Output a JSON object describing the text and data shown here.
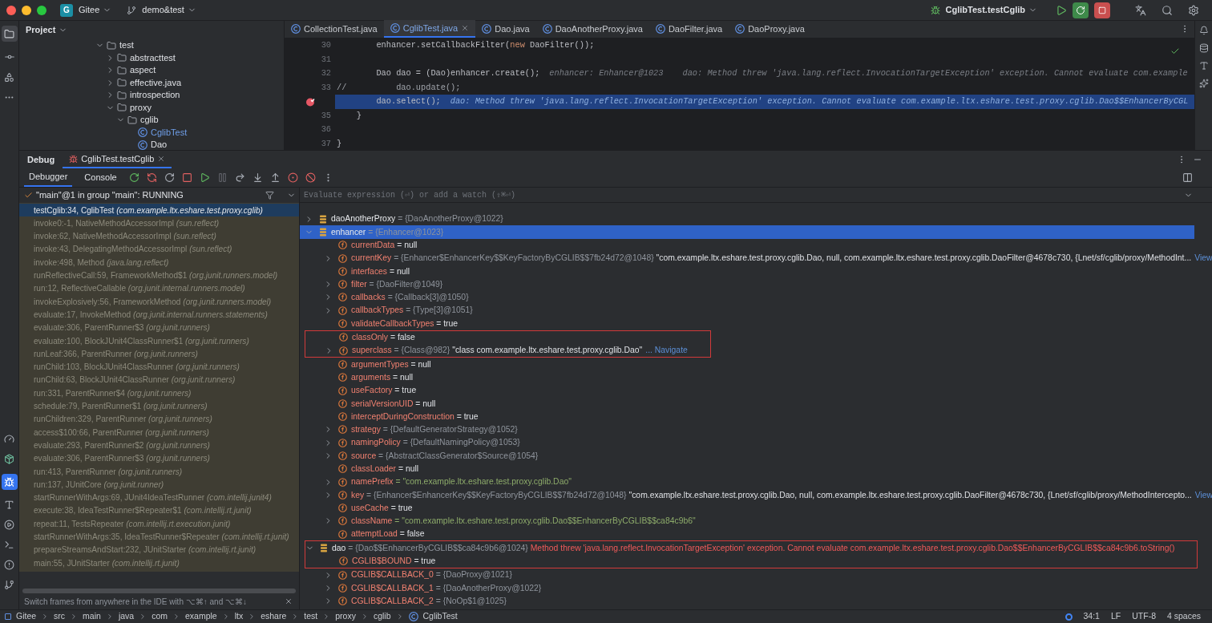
{
  "title_bar": {
    "project_badge": "G",
    "project": "Gitee",
    "branch": "demo&test",
    "run_config": "CglibTest.testCglib"
  },
  "project_panel": {
    "title": "Project",
    "tree": [
      {
        "label": "test",
        "kind": "folder",
        "expanded": true,
        "selected": false,
        "children": [
          {
            "label": "abstracttest",
            "kind": "folder",
            "expanded": false,
            "selected": false
          },
          {
            "label": "aspect",
            "kind": "folder",
            "expanded": false,
            "selected": false
          },
          {
            "label": "effective.java",
            "kind": "folder",
            "expanded": false,
            "selected": false
          },
          {
            "label": "introspection",
            "kind": "folder",
            "expanded": false,
            "selected": false
          },
          {
            "label": "proxy",
            "kind": "folder",
            "expanded": true,
            "selected": false,
            "children": [
              {
                "label": "cglib",
                "kind": "folder",
                "expanded": true,
                "selected": false,
                "children": [
                  {
                    "label": "CglibTest",
                    "kind": "class",
                    "selected": true
                  },
                  {
                    "label": "Dao",
                    "kind": "class",
                    "selected": false
                  }
                ]
              }
            ]
          }
        ]
      }
    ]
  },
  "editor": {
    "tabs": [
      {
        "label": "CollectionTest.java",
        "selected": false
      },
      {
        "label": "CglibTest.java",
        "selected": true
      },
      {
        "label": "Dao.java",
        "selected": false
      },
      {
        "label": "DaoAnotherProxy.java",
        "selected": false
      },
      {
        "label": "DaoFilter.java",
        "selected": false
      },
      {
        "label": "DaoProxy.java",
        "selected": false
      }
    ],
    "lines": [
      {
        "number": "30",
        "current": false,
        "breakpoint": false,
        "code": [
          {
            "text": "        enhancer.setCallbackFilter(",
            "kind": "plain"
          },
          {
            "text": "new",
            "kind": "keyword"
          },
          {
            "text": " DaoFilter());",
            "kind": "plain"
          }
        ]
      },
      {
        "number": "31",
        "current": false,
        "breakpoint": false
      },
      {
        "number": "32",
        "current": false,
        "breakpoint": false,
        "code": [
          {
            "text": "        Dao dao = (Dao)enhancer.create();",
            "kind": "plain"
          }
        ],
        "hints": [
          "enhancer: Enhancer@1023",
          "dao: Method threw 'java.lang.reflect.InvocationTargetException' exception. Cannot evaluate com.example"
        ]
      },
      {
        "number": "33",
        "current": false,
        "breakpoint": false,
        "code": [
          {
            "text": "//          dao.update();",
            "kind": "comment"
          }
        ]
      },
      {
        "current": true,
        "breakpoint": true,
        "code": [
          {
            "text": "        dao.select();",
            "kind": "plain"
          }
        ],
        "hints": [
          "dao: Method threw 'java.lang.reflect.InvocationTargetException' exception. Cannot evaluate com.example.ltx.eshare.test.proxy.cglib.Dao$$EnhancerByCGL"
        ]
      },
      {
        "number": "35",
        "current": false,
        "breakpoint": false,
        "code": [
          {
            "text": "    }",
            "kind": "plain"
          }
        ]
      },
      {
        "number": "36",
        "current": false,
        "breakpoint": false
      },
      {
        "number": "37",
        "current": false,
        "breakpoint": false,
        "code": [
          {
            "text": "}",
            "kind": "plain"
          }
        ]
      }
    ]
  },
  "debug": {
    "title": "Debug",
    "session": "CglibTest.testCglib",
    "tabs": [
      {
        "label": "Debugger",
        "selected": true
      },
      {
        "label": "Console",
        "selected": false
      }
    ],
    "thread": "\"main\"@1 in group \"main\": RUNNING",
    "frames": [
      {
        "text": "testCglib:34, CglibTest *(com.example.ltx.eshare.test.proxy.cglib)*",
        "selected": true
      },
      {
        "text": "invoke0:-1, NativeMethodAccessorImpl *(sun.reflect)*",
        "selected": false
      },
      {
        "text": "invoke:62, NativeMethodAccessorImpl *(sun.reflect)*",
        "selected": false
      },
      {
        "text": "invoke:43, DelegatingMethodAccessorImpl *(sun.reflect)*",
        "selected": false
      },
      {
        "text": "invoke:498, Method *(java.lang.reflect)*",
        "selected": false
      },
      {
        "text": "runReflectiveCall:59, FrameworkMethod$1 *(org.junit.runners.model)*",
        "selected": false
      },
      {
        "text": "run:12, ReflectiveCallable *(org.junit.internal.runners.model)*",
        "selected": false
      },
      {
        "text": "invokeExplosively:56, FrameworkMethod *(org.junit.runners.model)*",
        "selected": false
      },
      {
        "text": "evaluate:17, InvokeMethod *(org.junit.internal.runners.statements)*",
        "selected": false
      },
      {
        "text": "evaluate:306, ParentRunner$3 *(org.junit.runners)*",
        "selected": false
      },
      {
        "text": "evaluate:100, BlockJUnit4ClassRunner$1 *(org.junit.runners)*",
        "selected": false
      },
      {
        "text": "runLeaf:366, ParentRunner *(org.junit.runners)*",
        "selected": false
      },
      {
        "text": "runChild:103, BlockJUnit4ClassRunner *(org.junit.runners)*",
        "selected": false
      },
      {
        "text": "runChild:63, BlockJUnit4ClassRunner *(org.junit.runners)*",
        "selected": false
      },
      {
        "text": "run:331, ParentRunner$4 *(org.junit.runners)*",
        "selected": false
      },
      {
        "text": "schedule:79, ParentRunner$1 *(org.junit.runners)*",
        "selected": false
      },
      {
        "text": "runChildren:329, ParentRunner *(org.junit.runners)*",
        "selected": false
      },
      {
        "text": "access$100:66, ParentRunner *(org.junit.runners)*",
        "selected": false
      },
      {
        "text": "evaluate:293, ParentRunner$2 *(org.junit.runners)*",
        "selected": false
      },
      {
        "text": "evaluate:306, ParentRunner$3 *(org.junit.runners)*",
        "selected": false
      },
      {
        "text": "run:413, ParentRunner *(org.junit.runners)*",
        "selected": false
      },
      {
        "text": "run:137, JUnitCore *(org.junit.runner)*",
        "selected": false
      },
      {
        "text": "startRunnerWithArgs:69, JUnit4IdeaTestRunner *(com.intellij.junit4)*",
        "selected": false
      },
      {
        "text": "execute:38, IdeaTestRunner$Repeater$1 *(com.intellij.rt.junit)*",
        "selected": false
      },
      {
        "text": "repeat:11, TestsRepeater *(com.intellij.rt.execution.junit)*",
        "selected": false
      },
      {
        "text": "startRunnerWithArgs:35, IdeaTestRunner$Repeater *(com.intellij.rt.junit)*",
        "selected": false
      },
      {
        "text": "prepareStreamsAndStart:232, JUnitStarter *(com.intellij.rt.junit)*",
        "selected": false
      },
      {
        "text": "main:55, JUnitStarter *(com.intellij.rt.junit)*",
        "selected": false
      }
    ],
    "frames_hint": "Switch frames from anywhere in the IDE with ⌥⌘↑ and ⌥⌘↓",
    "evaluate_placeholder": "Evaluate expression (⏎) or add a watch (⇧⌘⏎)",
    "variables": [
      {
        "name": "daoAnotherProxy",
        "kind": "local",
        "expanded": false,
        "selected": false,
        "type": "= {DaoAnotherProxy@1022}"
      },
      {
        "name": "enhancer",
        "kind": "local",
        "expanded": true,
        "selected": true,
        "type": "= {Enhancer@1023}",
        "children": [
          {
            "name": "currentData",
            "kind": "field",
            "selected": false,
            "value": "= null"
          },
          {
            "name": "currentKey",
            "kind": "field",
            "expanded": false,
            "selected": false,
            "type": "= {Enhancer$EnhancerKey$$KeyFactoryByCGLIB$$7fb24d72@1048}",
            "detail": "\"com.example.ltx.eshare.test.proxy.cglib.Dao, null, com.example.ltx.eshare.test.proxy.cglib.DaoFilter@4678c730, {Lnet/sf/cglib/proxy/MethodInt...",
            "link": "View"
          },
          {
            "name": "interfaces",
            "kind": "field",
            "selected": false,
            "value": "= null"
          },
          {
            "name": "filter",
            "kind": "field",
            "expanded": false,
            "selected": false,
            "type": "= {DaoFilter@1049}"
          },
          {
            "name": "callbacks",
            "kind": "field",
            "expanded": false,
            "selected": false,
            "type": "= {Callback[3]@1050}"
          },
          {
            "name": "callbackTypes",
            "kind": "field",
            "expanded": false,
            "selected": false,
            "type": "= {Type[3]@1051}"
          },
          {
            "name": "validateCallbackTypes",
            "kind": "field",
            "selected": false,
            "value": "= true"
          },
          {
            "name": "classOnly",
            "kind": "field",
            "selected": false,
            "marked": true,
            "value": "= false"
          },
          {
            "name": "superclass",
            "kind": "field",
            "expanded": false,
            "selected": false,
            "marked": true,
            "type": "= {Class@982}",
            "detail": "\"class com.example.ltx.eshare.test.proxy.cglib.Dao\"",
            "link": "... Navigate"
          },
          {
            "name": "argumentTypes",
            "kind": "field",
            "selected": false,
            "value": "= null"
          },
          {
            "name": "arguments",
            "kind": "field",
            "selected": false,
            "value": "= null"
          },
          {
            "name": "useFactory",
            "kind": "field",
            "selected": false,
            "value": "= true"
          },
          {
            "name": "serialVersionUID",
            "kind": "field",
            "selected": false,
            "value": "= null"
          },
          {
            "name": "interceptDuringConstruction",
            "kind": "field",
            "selected": false,
            "value": "= true"
          },
          {
            "name": "strategy",
            "kind": "field",
            "expanded": false,
            "selected": false,
            "type": "= {DefaultGeneratorStrategy@1052}"
          },
          {
            "name": "namingPolicy",
            "kind": "field",
            "expanded": false,
            "selected": false,
            "type": "= {DefaultNamingPolicy@1053}"
          },
          {
            "name": "source",
            "kind": "field",
            "expanded": false,
            "selected": false,
            "type": "= {AbstractClassGenerator$Source@1054}"
          },
          {
            "name": "classLoader",
            "kind": "field",
            "selected": false,
            "value": "= null"
          },
          {
            "name": "namePrefix",
            "kind": "field",
            "expanded": false,
            "selected": false,
            "string": "= \"com.example.ltx.eshare.test.proxy.cglib.Dao\""
          },
          {
            "name": "key",
            "kind": "field",
            "expanded": false,
            "selected": false,
            "type": "= {Enhancer$EnhancerKey$$KeyFactoryByCGLIB$$7fb24d72@1048}",
            "detail": "\"com.example.ltx.eshare.test.proxy.cglib.Dao, null, com.example.ltx.eshare.test.proxy.cglib.DaoFilter@4678c730, {Lnet/sf/cglib/proxy/MethodIntercepto...",
            "link": "View"
          },
          {
            "name": "useCache",
            "kind": "field",
            "selected": false,
            "value": "= true"
          },
          {
            "name": "className",
            "kind": "field",
            "expanded": false,
            "selected": false,
            "string": "= \"com.example.ltx.eshare.test.proxy.cglib.Dao$$EnhancerByCGLIB$$ca84c9b6\""
          },
          {
            "name": "attemptLoad",
            "kind": "field",
            "selected": false,
            "value": "= false"
          }
        ]
      },
      {
        "name": "dao",
        "kind": "local",
        "expanded": true,
        "selected": false,
        "marked": true,
        "type": "= {Dao$$EnhancerByCGLIB$$ca84c9b6@1024}",
        "error": "Method threw 'java.lang.reflect.InvocationTargetException' exception. Cannot evaluate com.example.ltx.eshare.test.proxy.cglib.Dao$$EnhancerByCGLIB$$ca84c9b6.toString()",
        "children": [
          {
            "name": "CGLIB$BOUND",
            "kind": "field",
            "selected": false,
            "marked": true,
            "value": "= true"
          },
          {
            "name": "CGLIB$CALLBACK_0",
            "kind": "field",
            "expanded": false,
            "selected": false,
            "type": "= {DaoProxy@1021}"
          },
          {
            "name": "CGLIB$CALLBACK_1",
            "kind": "field",
            "expanded": false,
            "selected": false,
            "type": "= {DaoAnotherProxy@1022}"
          },
          {
            "name": "CGLIB$CALLBACK_2",
            "kind": "field",
            "expanded": false,
            "selected": false,
            "type": "= {NoOp$1@1025}"
          }
        ]
      }
    ]
  },
  "status_bar": {
    "breadcrumbs": [
      "Gitee",
      "src",
      "main",
      "java",
      "com",
      "example",
      "ltx",
      "eshare",
      "test",
      "proxy",
      "cglib",
      "CglibTest"
    ],
    "position": "34:1",
    "line_separator": "LF",
    "encoding": "UTF-8",
    "indent": "4 spaces"
  }
}
